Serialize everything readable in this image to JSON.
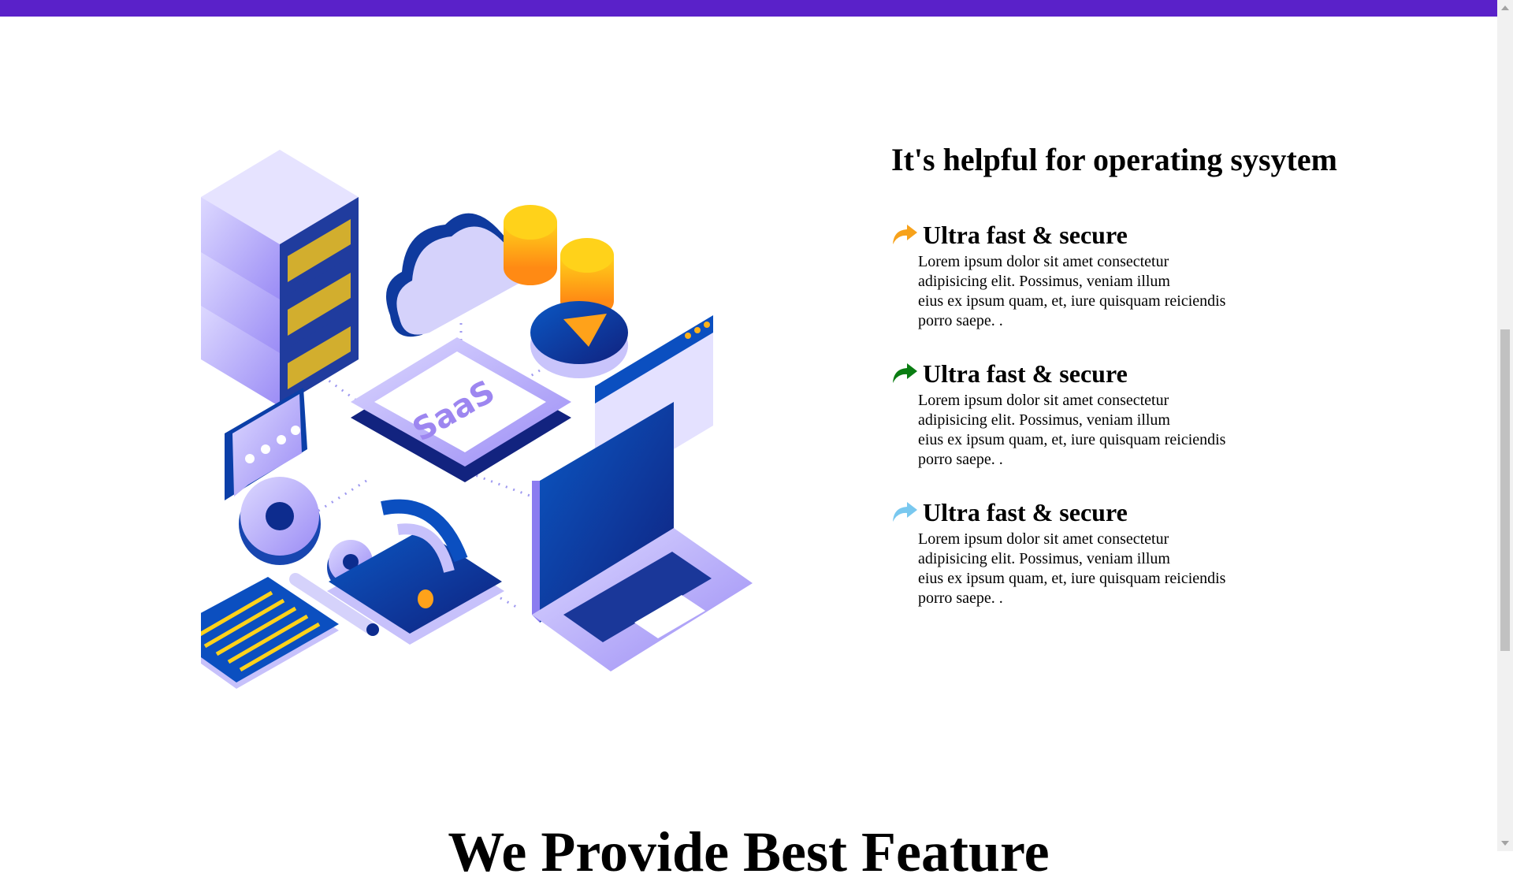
{
  "section": {
    "title": "It's helpful for operating sysytem",
    "features": [
      {
        "title": "Ultra fast & secure",
        "icon": "share-arrow-icon",
        "color": "#f7a21b",
        "lines": [
          "Lorem ipsum dolor sit amet consectetur",
          "adipisicing elit. Possimus, veniam illum",
          "eius ex ipsum quam, et, iure quisquam reiciendis",
          "porro saepe. ."
        ]
      },
      {
        "title": "Ultra fast & secure",
        "icon": "share-arrow-icon",
        "color": "#0a7d12",
        "lines": [
          "Lorem ipsum dolor sit amet consectetur",
          "adipisicing elit. Possimus, veniam illum",
          "eius ex ipsum quam, et, iure quisquam reiciendis",
          "porro saepe. ."
        ]
      },
      {
        "title": "Ultra fast & secure",
        "icon": "share-arrow-icon",
        "color": "#79c8ef",
        "lines": [
          "Lorem ipsum dolor sit amet consectetur",
          "adipisicing elit. Possimus, veniam illum",
          "eius ex ipsum quam, et, iure quisquam reiciendis",
          "porro saepe. ."
        ]
      }
    ]
  },
  "illustration": {
    "label": "SaaS"
  },
  "bottom_heading": "We Provide Best Feature",
  "colors": {
    "topbar": "#5a21c9"
  }
}
